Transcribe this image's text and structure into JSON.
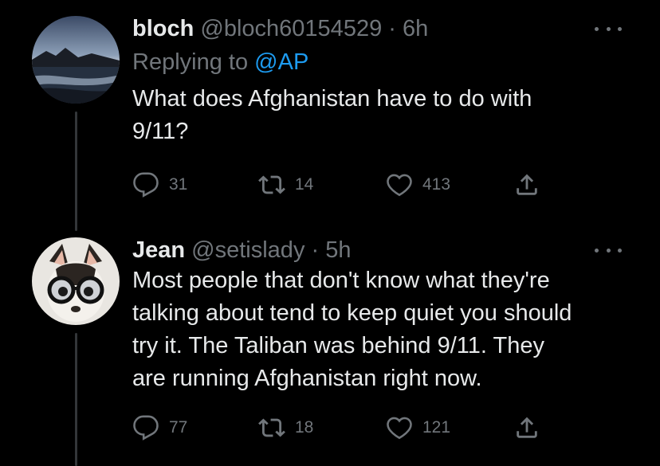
{
  "colors": {
    "background": "#000000",
    "text": "#e7e9ea",
    "muted": "#71767b",
    "accent": "#1d9bf0",
    "thread_line": "#333639"
  },
  "tweets": [
    {
      "name": "bloch",
      "handle": "@bloch60154529",
      "separator": "·",
      "time": "6h",
      "replying_prefix": "Replying to ",
      "replying_mention": "@AP",
      "body_line1": "What does Afghanistan have to do with",
      "body_line2": "9/11?",
      "reply_count": "31",
      "retweet_count": "14",
      "like_count": "413",
      "avatar_icon": "landscape-sunset-avatar"
    },
    {
      "name": "Jean",
      "handle": "@setislady",
      "separator": "·",
      "time": "5h",
      "body_line1": "Most people that don't know what they're",
      "body_line2": "talking about tend to keep quiet you should",
      "body_line3": "try it. The Taliban was behind 9/11. They",
      "body_line4": "are running Afghanistan right now.",
      "reply_count": "77",
      "retweet_count": "18",
      "like_count": "121",
      "avatar_icon": "chihuahua-with-glasses-avatar"
    }
  ],
  "icons": {
    "reply": "reply-icon",
    "retweet": "retweet-icon",
    "like": "heart-icon",
    "share": "share-icon",
    "more": "more-icon"
  }
}
